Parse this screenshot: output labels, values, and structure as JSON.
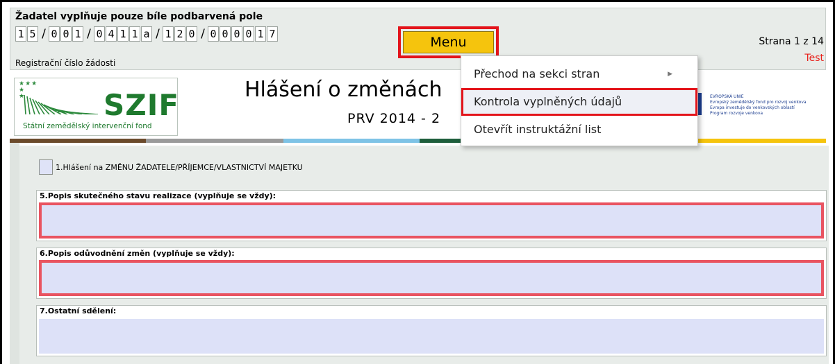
{
  "header": {
    "applicant_note": "Žadatel vyplňuje pouze bíle podbarvená pole",
    "registration_number": [
      "1",
      "5",
      "/",
      "0",
      "0",
      "1",
      "/",
      "0",
      "4",
      "1",
      "1",
      "a",
      "/",
      "1",
      "2",
      "0",
      "/",
      "0",
      "0",
      "0",
      "0",
      "1",
      "7"
    ],
    "registration_label": "Registrační číslo žádosti",
    "menu_label": "Menu",
    "page_indicator": "Strana 1 z 14",
    "test_label": "Test"
  },
  "logo": {
    "name": "SZIF",
    "subtitle": "Státní zemědělský intervenční fond"
  },
  "form": {
    "title": "Hlášení o změnách",
    "subtitle": "PRV 2014 - 2"
  },
  "eu": {
    "line1": "EVROPSKÁ UNIE",
    "line2": "Evropský zemědělský fond pro rozvoj venkova",
    "line3": "Evropa investuje do venkovských oblastí",
    "line4": "Program rozvoje venkova"
  },
  "dropdown": {
    "items": [
      {
        "label": "Přechod na sekci stran",
        "has_submenu": true
      },
      {
        "label": "Kontrola vyplněných údajů",
        "highlighted": true
      },
      {
        "label": "Otevřít instruktážní list"
      }
    ]
  },
  "sections": {
    "checkbox_label": "1.Hlášení na ZMĚNU ŽADATELE/PŘÍJEMCE/VLASTNICTVÍ MAJETKU",
    "s5_label": "5.Popis skutečného stavu realizace (vyplňuje se vždy):",
    "s6_label": "6.Popis odůvodnění změn (vyplňuje se vždy):",
    "s7_label": "7.Ostatní sdělení:"
  },
  "colors": {
    "menu_button": "#f5c40d",
    "highlight_border": "#e3141b",
    "error_border": "#e95461",
    "input_fill": "#dde1f8",
    "logo_green": "#1f7a2e"
  }
}
